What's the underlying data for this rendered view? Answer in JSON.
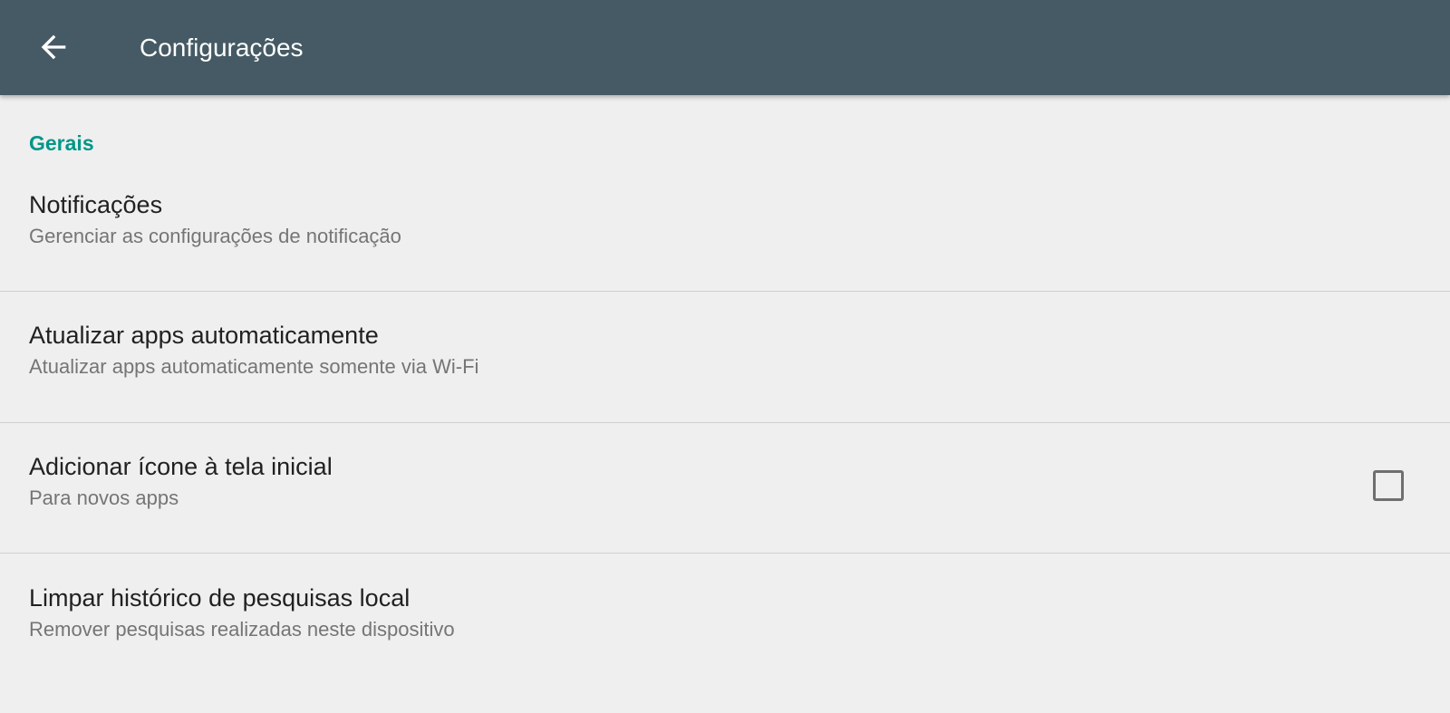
{
  "toolbar": {
    "title": "Configurações",
    "back_icon": "arrow-back-icon",
    "background_color": "#455a64"
  },
  "section": {
    "title": "Gerais",
    "accent_color": "#009688"
  },
  "preferences": [
    {
      "title": "Notificações",
      "summary": "Gerenciar as configurações de notificação"
    },
    {
      "title": "Atualizar apps automaticamente",
      "summary": "Atualizar apps automaticamente somente via Wi-Fi"
    },
    {
      "title": "Adicionar ícone à tela inicial",
      "summary": "Para novos apps",
      "checkbox_checked": false
    },
    {
      "title": "Limpar histórico de pesquisas local",
      "summary": "Remover pesquisas realizadas neste dispositivo"
    }
  ]
}
